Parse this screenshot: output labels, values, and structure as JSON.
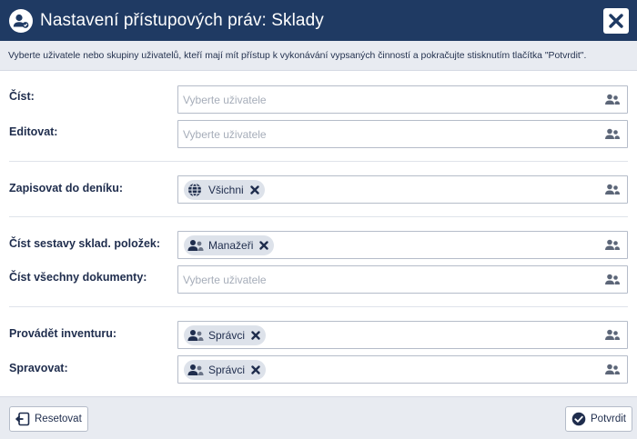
{
  "dialog": {
    "title": "Nastavení přístupových práv: Sklady",
    "instructions": "Vyberte uživatele nebo skupiny uživatelů, kteří mají mít přístup k vykonávání vypsaných činností a pokračujte stisknutím tlačítka \"Potvrdit\"."
  },
  "rows": [
    {
      "label": "Číst:",
      "placeholder": "Vyberte uživatele",
      "tag": null
    },
    {
      "label": "Editovat:",
      "placeholder": "Vyberte uživatele",
      "tag": null
    },
    {
      "label": "Zapisovat do deníku:",
      "placeholder": "",
      "tag": {
        "label": "Všichni",
        "icon": "globe-icon"
      }
    },
    {
      "label": "Číst sestavy sklad. položek:",
      "placeholder": "",
      "tag": {
        "label": "Manažeři",
        "icon": "user-group-icon"
      }
    },
    {
      "label": "Číst všechny dokumenty:",
      "placeholder": "Vyberte uživatele",
      "tag": null
    },
    {
      "label": "Provádět inventuru:",
      "placeholder": "",
      "tag": {
        "label": "Správci",
        "icon": "user-group-icon"
      }
    },
    {
      "label": "Spravovat:",
      "placeholder": "",
      "tag": {
        "label": "Správci",
        "icon": "user-group-icon"
      }
    }
  ],
  "footer": {
    "reset_label": "Resetovat",
    "confirm_label": "Potvrdit"
  },
  "colors": {
    "header_bg": "#1f3a63",
    "panel_bg": "#e8ebf1",
    "tag_bg": "#dde2ea",
    "text": "#1f2d4d"
  }
}
